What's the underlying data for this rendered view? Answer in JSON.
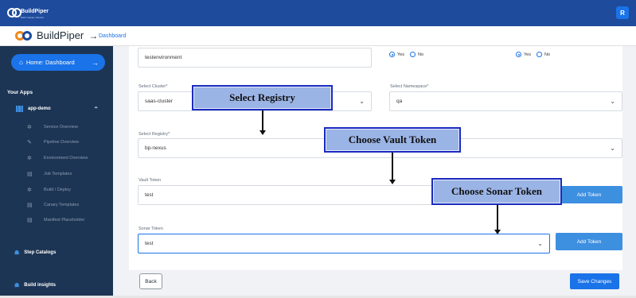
{
  "topbar": {
    "logo_text": "BuildPiper",
    "logo_sub": "Build. Deploy. Monitor.",
    "avatar_initial": "R"
  },
  "header": {
    "brand": "BuildPiper",
    "arrow": "→",
    "crumb": "Dashboard"
  },
  "sidebar": {
    "home_label": "Home: Dashboard",
    "your_apps": "Your Apps",
    "app_name": "app-demo",
    "items": [
      {
        "label": "Service Overview",
        "icon": "gear-icon"
      },
      {
        "label": "Pipeline Overview",
        "icon": "tools-icon"
      },
      {
        "label": "Environment Overview",
        "icon": "gear-icon"
      },
      {
        "label": "Job Templates",
        "icon": "document-icon"
      },
      {
        "label": "Build / Deploy",
        "icon": "gear-icon"
      },
      {
        "label": "Canary Templates",
        "icon": "document-icon"
      },
      {
        "label": "Manifest Placeholder",
        "icon": "document-icon"
      }
    ],
    "step_catalogs": "Step Catalogs",
    "build_insights": "Build insights"
  },
  "form": {
    "env_value": "testenvironment",
    "radio_yes": "Yes",
    "radio_no": "No",
    "cluster_label": "Select Cluster*",
    "cluster_value": "saas-cluster",
    "namespace_label": "Select Namespace*",
    "namespace_value": "qa",
    "registry_label": "Select Registry*",
    "registry_value": "bp-nexus",
    "vault_label": "Vault Token",
    "vault_value": "test",
    "sonar_label": "Sonar Token",
    "sonar_value": "test",
    "add_token": "Add Token"
  },
  "footer": {
    "back": "Back",
    "save": "Save Changes"
  },
  "callouts": {
    "registry": "Select Registry",
    "vault": "Choose  Vault Token",
    "sonar": "Choose Sonar Token"
  },
  "colors": {
    "topbar": "#1e4b9c",
    "sidebar": "#1d3554",
    "accent": "#1a73e8",
    "callout_fill": "#9bb4e6",
    "callout_border": "#1b2bbf"
  }
}
